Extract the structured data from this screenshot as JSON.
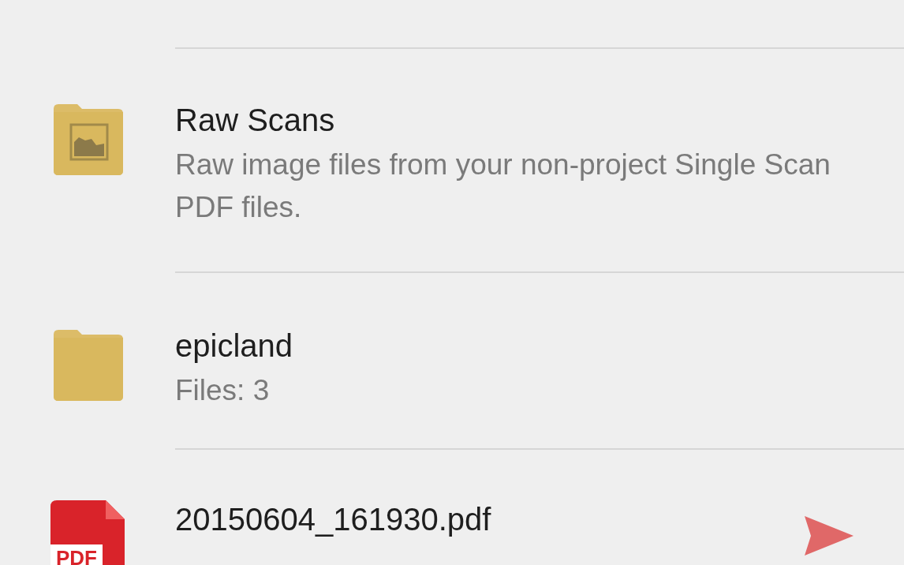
{
  "files": [
    {
      "kind": "image-folder",
      "name": "Raw Scans",
      "detail": "Raw image files from your non-project Single Scan PDF files."
    },
    {
      "kind": "folder",
      "name": "epicland",
      "detail": "Files: 3"
    },
    {
      "kind": "pdf",
      "name": "20150604_161930.pdf",
      "badge": "PDF"
    }
  ]
}
